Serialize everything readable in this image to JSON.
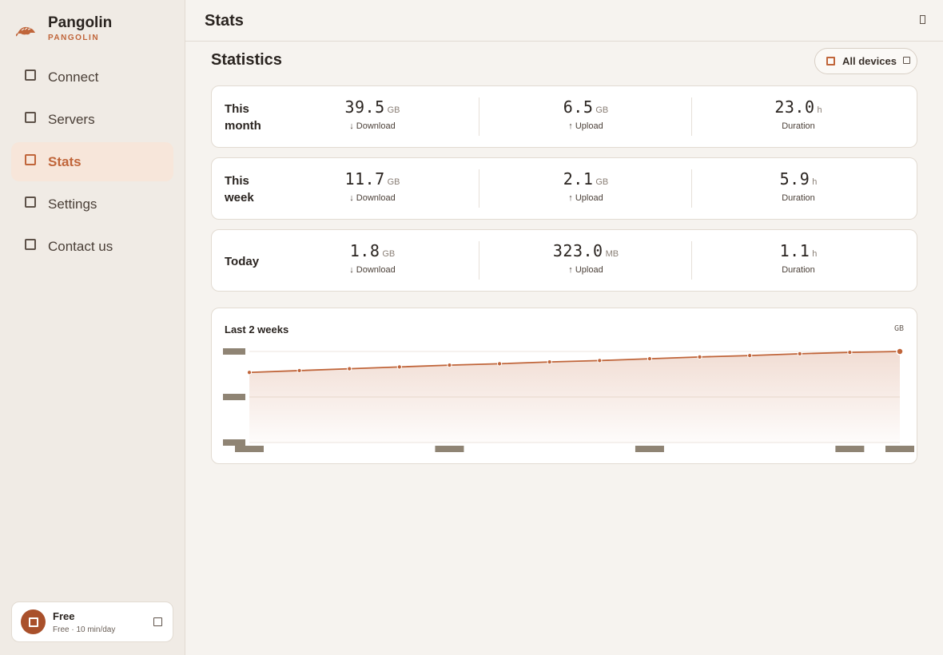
{
  "app": {
    "name": "Pangolin",
    "subtitle": "PANGOLIN"
  },
  "colors": {
    "accent": "#c0653a",
    "accent_soft": "#f7e6da",
    "background": "#f6f3ef",
    "sidebar": "#f0ebe5"
  },
  "sidebar": {
    "items": [
      {
        "label": "Connect",
        "icon": "square-icon",
        "active": false
      },
      {
        "label": "Servers",
        "icon": "square-icon",
        "active": false
      },
      {
        "label": "Stats",
        "icon": "square-icon",
        "active": true
      },
      {
        "label": "Settings",
        "icon": "square-icon",
        "active": false
      },
      {
        "label": "Contact us",
        "icon": "square-icon",
        "active": false
      }
    ]
  },
  "plan": {
    "name": "Free",
    "description": "Free · 10 min/day"
  },
  "header": {
    "title": "Stats"
  },
  "main": {
    "section_title": "Statistics",
    "device_filter": "All devices",
    "stats": [
      {
        "period": "This month",
        "download": {
          "value": "39.5",
          "unit": "GB",
          "label": "↓ Download"
        },
        "upload": {
          "value": "6.5",
          "unit": "GB",
          "label": "↑ Upload"
        },
        "duration": {
          "value": "23.0",
          "unit": "h",
          "label": "Duration"
        }
      },
      {
        "period": "This week",
        "download": {
          "value": "11.7",
          "unit": "GB",
          "label": "↓ Download"
        },
        "upload": {
          "value": "2.1",
          "unit": "GB",
          "label": "↑ Upload"
        },
        "duration": {
          "value": "5.9",
          "unit": "h",
          "label": "Duration"
        }
      },
      {
        "period": "Today",
        "download": {
          "value": "1.8",
          "unit": "GB",
          "label": "↓ Download"
        },
        "upload": {
          "value": "323.0",
          "unit": "MB",
          "label": "↑ Upload"
        },
        "duration": {
          "value": "1.1",
          "unit": "h",
          "label": "Duration"
        }
      }
    ],
    "chart_title": "Last 2 weeks",
    "chart_unit": "GB"
  },
  "chart_data": {
    "type": "area",
    "title": "Last 2 weeks",
    "ylabel": "GB",
    "grid": true,
    "x": [
      1,
      2,
      3,
      4,
      5,
      6,
      7,
      8,
      9,
      10,
      11,
      12,
      13,
      14
    ],
    "values": [
      1.54,
      1.58,
      1.62,
      1.66,
      1.7,
      1.73,
      1.77,
      1.8,
      1.84,
      1.88,
      1.91,
      1.95,
      1.98,
      2.0
    ],
    "ylim": [
      0,
      2.0
    ],
    "yticks": [
      0,
      1.0,
      2.0
    ],
    "xticks": [
      1,
      5,
      9,
      13,
      14
    ]
  }
}
